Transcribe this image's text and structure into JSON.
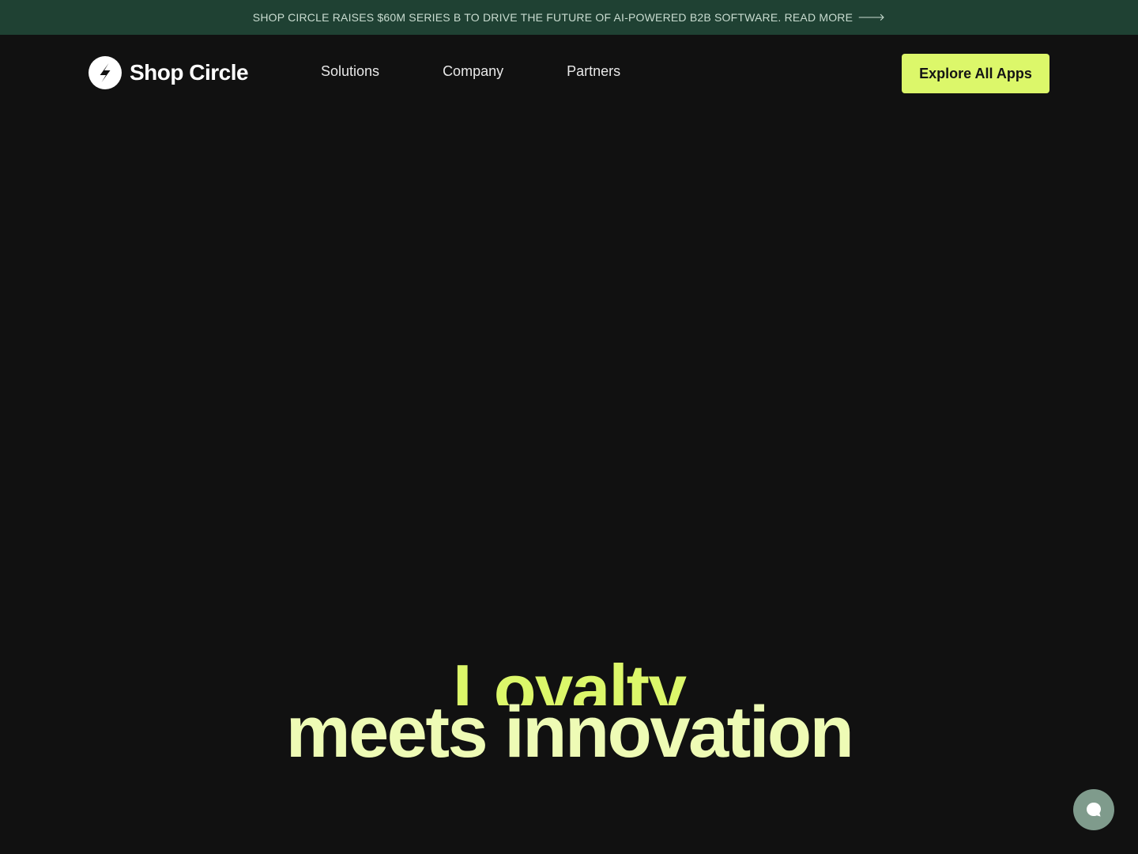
{
  "announcement": {
    "text": "SHOP CIRCLE RAISES $60M SERIES B TO DRIVE THE FUTURE OF AI-POWERED B2B SOFTWARE. READ MORE",
    "arrow": "🡒"
  },
  "header": {
    "logo_text": "Shop Circle",
    "nav": [
      {
        "label": "Solutions"
      },
      {
        "label": "Company"
      },
      {
        "label": "Partners"
      }
    ],
    "cta_label": "Explore All Apps"
  },
  "hero": {
    "line1": "Loyalty",
    "line2": "meets innovation"
  },
  "icons": {
    "logo": "shop-circle-logo-icon",
    "chat": "chat-bubble-icon"
  },
  "colors": {
    "background": "#111111",
    "banner": "#1f4133",
    "accent": "#dcf76a",
    "headline_light": "#eefbb5",
    "chat_button": "#7f9b8c"
  }
}
